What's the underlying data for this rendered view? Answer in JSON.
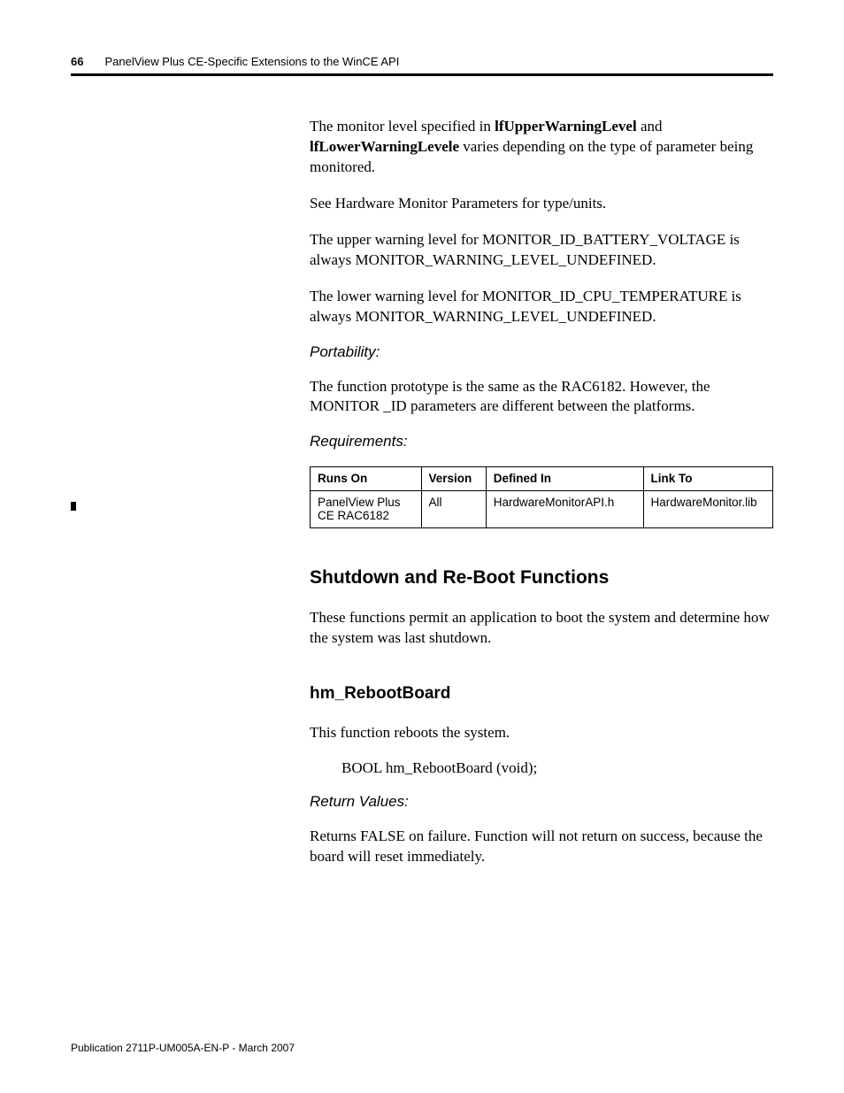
{
  "header": {
    "page_number": "66",
    "title": "PanelView Plus CE-Specific Extensions to the WinCE API"
  },
  "body": {
    "p1_pre": "The monitor level specified in ",
    "p1_b1": "lfUpperWarningLevel",
    "p1_mid": " and ",
    "p1_b2": "lfLowerWarningLevele",
    "p1_post": " varies depending on the type of parameter being monitored.",
    "p2": "See Hardware Monitor Parameters for type/units.",
    "p3": "The upper warning level for MONITOR_ID_BATTERY_VOLTAGE is always MONITOR_WARNING_LEVEL_UNDEFINED.",
    "p4": "The lower warning level for MONITOR_ID_CPU_TEMPERATURE is always MONITOR_WARNING_LEVEL_UNDEFINED.",
    "portability_label": "Portability:",
    "p5": "The function prototype is the same as the RAC6182. However, the MONITOR _ID parameters are different between the platforms.",
    "requirements_label": "Requirements:",
    "table": {
      "headers": {
        "runs_on": "Runs On",
        "version": "Version",
        "defined_in": "Defined In",
        "link_to": "Link To"
      },
      "row": {
        "runs_on": "PanelView Plus CE RAC6182",
        "version": "All",
        "defined_in": "HardwareMonitorAPI.h",
        "link_to": "HardwareMonitor.lib"
      }
    },
    "section1_heading": "Shutdown and Re-Boot Functions",
    "p6": "These functions permit an application to boot the system and determine how the system was last shutdown.",
    "section2_heading": "hm_RebootBoard",
    "p7": "This function reboots the system.",
    "proto": "BOOL hm_RebootBoard (void);",
    "return_label": "Return Values:",
    "p8": "Returns FALSE on failure. Function will not return on success, because the board will reset immediately."
  },
  "footer": {
    "pub": "Publication 2711P-UM005A-EN-P - March 2007"
  }
}
